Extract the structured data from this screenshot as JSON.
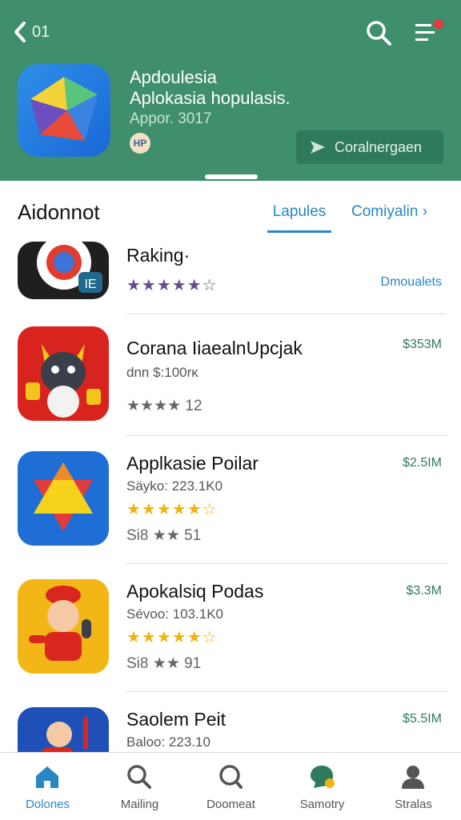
{
  "header": {
    "back_number": "01",
    "app_title": "Apdoulesia",
    "app_subtitle": "Aplokasia hopulasis.",
    "app_meta": "Appor. 3017",
    "badge_text": "HP",
    "cta_label": "Coralnergaen",
    "bg_color": "#3f8f6c"
  },
  "section": {
    "title": "Aidonnot",
    "tab_active": "Lapules",
    "tab_other": "Comiyalin ›"
  },
  "apps": [
    {
      "name": "Raking·",
      "meta": "",
      "stars": "★★★★★☆",
      "rating_text": "",
      "price": "Dmoualets",
      "icon": "browser-icon"
    },
    {
      "name": "Corana IiaealnUpcjak",
      "meta": "dnn $:100rĸ",
      "stars": "",
      "rating_text": "★★★★ 12",
      "price": "$353M",
      "icon": "wolf-character-icon"
    },
    {
      "name": "Applkasie Poilar",
      "meta": "Säyko: 223.1K0",
      "stars": "★★★★★☆",
      "rating_text": "Si8 ★★ 51",
      "price": "$2.5IM",
      "icon": "star-triangle-icon"
    },
    {
      "name": "Apokalsiq Podas",
      "meta": "Sévoo: 103.1K0",
      "stars": "★★★★★☆",
      "rating_text": "Si8 ★★ 91",
      "price": "$3.3M",
      "icon": "cartoon-boy-icon"
    },
    {
      "name": "Saolem Peit",
      "meta": "Baloo: 223.10",
      "stars": "",
      "rating_text": "",
      "price": "$5.5IM",
      "icon": "character-icon"
    }
  ],
  "bottom_nav": [
    {
      "label": "Dolones",
      "icon": "home-icon",
      "active": true
    },
    {
      "label": "Mailing",
      "icon": "search-icon",
      "active": false
    },
    {
      "label": "Doomeat",
      "icon": "search-icon",
      "active": false
    },
    {
      "label": "Samotry",
      "icon": "chat-icon",
      "active": false
    },
    {
      "label": "Stralas",
      "icon": "person-icon",
      "active": false
    }
  ],
  "colors": {
    "accent_blue": "#2a86c2",
    "price_green": "#2f7a5a",
    "star_gold": "#f2b40a",
    "star_purple": "#6a4c8f"
  }
}
